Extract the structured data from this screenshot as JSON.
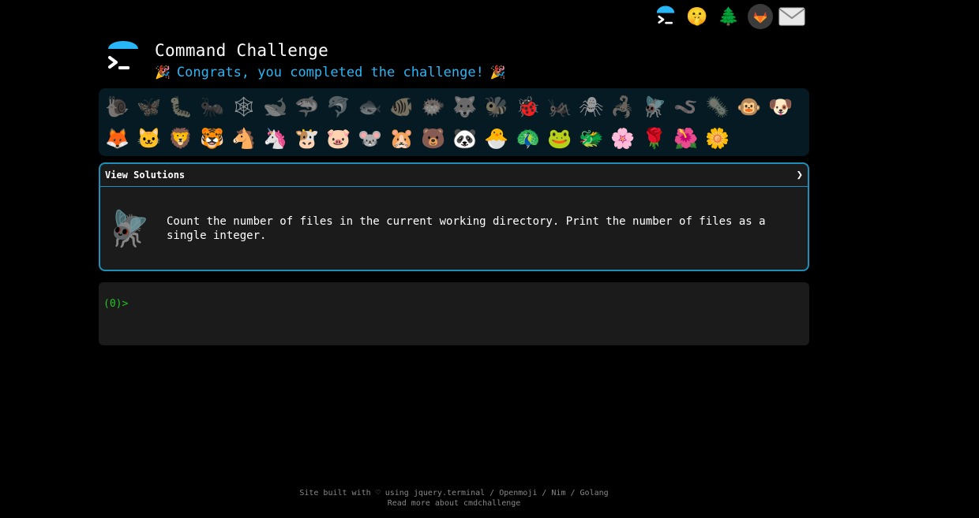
{
  "topbar": {
    "icons": [
      "terminal-logo-icon",
      "shushing-face-icon",
      "evergreen-tree-icon",
      "gitlab-icon",
      "envelope-icon"
    ]
  },
  "header": {
    "title": "Command Challenge",
    "subtitle": "Congrats, you completed the challenge!"
  },
  "emojis": {
    "row1": [
      "🐌",
      "🦋",
      "🐛",
      "🐜",
      "🕸",
      "🐋",
      "🦈",
      "🐬",
      "🐟",
      "🐠",
      "🐡",
      "🐺",
      "🐝",
      "🐞",
      "🦗",
      "🕷",
      "🦂",
      "🪰",
      "🪱",
      "🦠",
      "🐵",
      "🐶"
    ],
    "row2": [
      "🦊",
      "🐱",
      "🦁",
      "🐯",
      "🐴",
      "🦄",
      "🐮",
      "🐷",
      "🐭",
      "🐹",
      "🐻",
      "🐼",
      "🐣",
      "🦚",
      "🐸",
      "🐲",
      "🌸",
      "🌹",
      "🌺",
      "🌼"
    ],
    "done_row1": [
      13,
      17,
      20,
      21
    ],
    "done_row2": [
      0,
      1,
      2,
      3,
      4,
      5,
      6,
      7,
      8,
      9,
      10,
      11,
      12,
      13,
      14,
      15,
      16,
      17,
      18,
      19
    ]
  },
  "solution": {
    "header": "View Solutions",
    "chevron": "❯",
    "icon": "🪰",
    "description": "Count the number of files in the current working directory. Print the number of files as a single integer."
  },
  "terminal": {
    "prompt": "(0)>"
  },
  "footer": {
    "line1": "Site built with ♡ using jquery.terminal / Openmoji / Nim / Golang",
    "line2": "Read more about cmdchallenge"
  },
  "colors": {
    "accent": "#29b6f6",
    "border": "#1e8fb8",
    "prompt": "#22c322"
  }
}
